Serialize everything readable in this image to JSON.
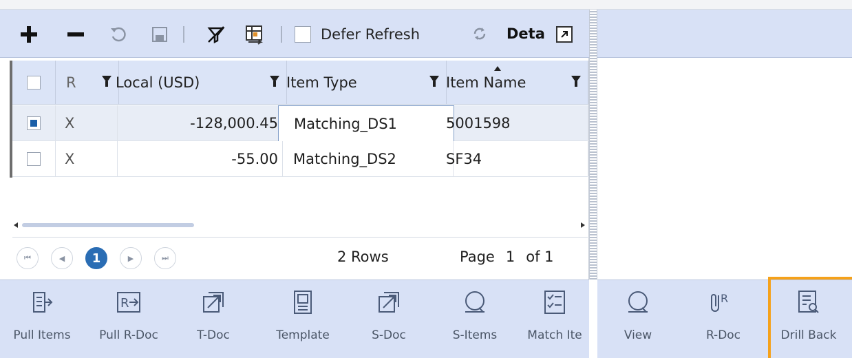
{
  "toolbar": {
    "defer_refresh_label": "Defer Refresh",
    "details_label": "Deta"
  },
  "grid": {
    "columns": [
      {
        "label": "R"
      },
      {
        "label": "Local (USD)"
      },
      {
        "label": "Item Type"
      },
      {
        "label": "Item Name"
      }
    ],
    "rows": [
      {
        "checked": true,
        "r": "X",
        "local": "-128,000.45",
        "item_type": "Matching_DS1",
        "item_name": "5001598"
      },
      {
        "checked": false,
        "r": "X",
        "local": "-55.00",
        "item_type": "Matching_DS2",
        "item_name": "SF34"
      }
    ]
  },
  "pager": {
    "current_page_button": "1",
    "rows_text": "2 Rows",
    "page_label": "Page",
    "page_value": "1",
    "of_label": "of 1"
  },
  "bottom_actions": {
    "pull_items": "Pull Items",
    "pull_rdoc": "Pull R-Doc",
    "tdoc": "T-Doc",
    "template": "Template",
    "sdoc": "S-Doc",
    "sitems": "S-Items",
    "match_items": "Match Ite",
    "view": "View",
    "rdoc": "R-Doc",
    "drill_back": "Drill Back"
  },
  "colors": {
    "toolbar_bg": "#d8e1f6",
    "accent": "#1b5fa8",
    "highlight": "#f5a11a"
  },
  "icons": [
    "add-icon",
    "remove-icon",
    "undo-icon",
    "save-icon",
    "clear-filter-icon",
    "column-chooser-icon",
    "refresh-icon",
    "popout-icon",
    "pull-items-icon",
    "pull-rdoc-icon",
    "tdoc-icon",
    "template-icon",
    "sdoc-icon",
    "sitems-icon",
    "match-items-icon",
    "view-icon",
    "rdoc-icon",
    "drill-back-icon"
  ]
}
